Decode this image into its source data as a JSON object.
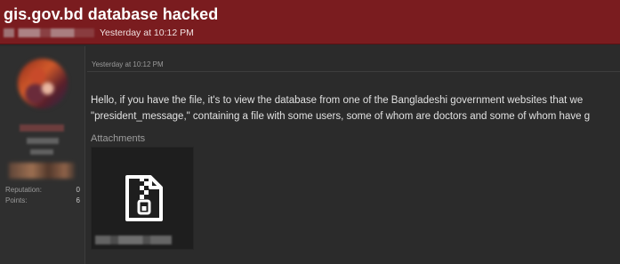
{
  "thread": {
    "title": "gis.gov.bd database hacked",
    "date": "Yesterday at 10:12 PM"
  },
  "sidebar": {
    "stats": [
      {
        "label": "Reputation:",
        "value": "0"
      },
      {
        "label": "Points:",
        "value": "6"
      }
    ]
  },
  "post": {
    "date": "Yesterday at 10:12 PM",
    "line1": "Hello, if you have the file, it's to view the database from one of the Bangladeshi government websites that we",
    "line2": "\"president_message,\" containing a file with some users, some of whom are doctors and some of whom have g",
    "attachments_heading": "Attachments",
    "attachment_icon": "zip-file-icon"
  },
  "colors": {
    "header_bg": "#7a1c1f",
    "page_bg": "#2b2b2b",
    "sidebar_bg": "#2f2f2f",
    "attachment_bg": "#1e1e1e"
  }
}
